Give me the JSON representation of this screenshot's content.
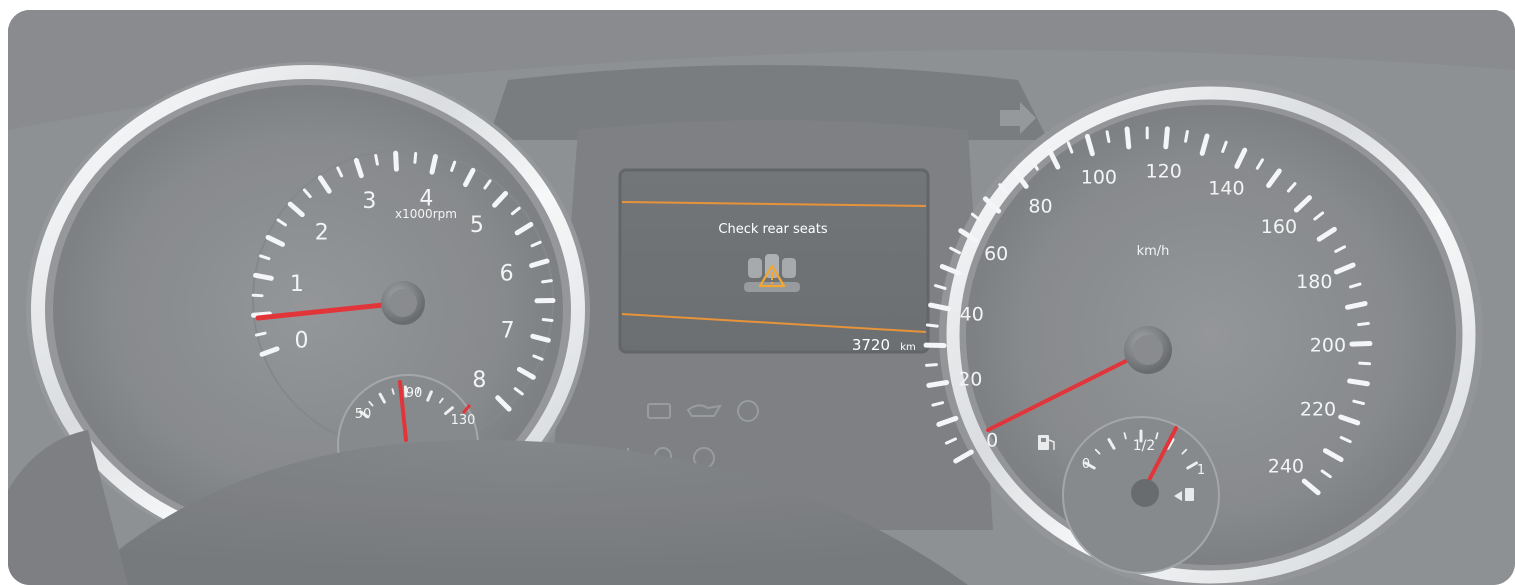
{
  "tachometer": {
    "labels": [
      "0",
      "1",
      "2",
      "3",
      "4",
      "5",
      "6",
      "7",
      "8"
    ],
    "unit": "x1000rpm",
    "needle_value": 1.0,
    "needle_color": "#e0242a"
  },
  "temperature_gauge": {
    "labels": [
      "50",
      "90",
      "130"
    ]
  },
  "speedometer": {
    "labels": [
      "0",
      "20",
      "40",
      "60",
      "80",
      "100",
      "120",
      "140",
      "160",
      "180",
      "200",
      "220",
      "240"
    ],
    "unit": "km/h",
    "needle_value": 0,
    "needle_color": "#e0242a"
  },
  "fuel_gauge": {
    "labels": [
      "0",
      "1/2",
      "1"
    ],
    "level": 0.75
  },
  "center_display": {
    "message": "Check rear seats",
    "odometer_value": "3720",
    "odometer_unit": "km",
    "accent_color": "#e58a2a",
    "icon": "rear-seats-warning-icon"
  },
  "indicator_lights": [
    "battery-icon",
    "oil-pressure-icon",
    "brake-warning-icon",
    "tire-pressure-icon"
  ]
}
